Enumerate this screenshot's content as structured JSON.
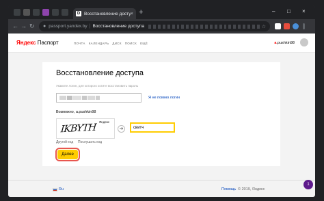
{
  "browser": {
    "tab_favicon": "D",
    "tab_title": "Восстановление досту",
    "tab_close_glyph": "×",
    "new_tab_glyph": "+",
    "window_controls": {
      "minimize": "–",
      "maximize": "□",
      "close": "×"
    },
    "nav": {
      "back": "←",
      "forward": "→",
      "reload": "↻"
    },
    "url_host": "passport.yandex.by",
    "url_title": "Восстановление доступа",
    "icons": [
      "back-icon",
      "forward-icon",
      "reload-icon",
      "lock-icon",
      "star-icon",
      "extension-icon",
      "profile-icon",
      "menu-icon"
    ]
  },
  "header": {
    "logo_brand": "Яндекс",
    "logo_product": "Паспорт",
    "nav": [
      "ПОЧТА",
      "КАЛЕНДАРЬ",
      "ДИСК",
      "ПОИСК",
      "ЕЩЁ"
    ],
    "user_first": "a",
    "user_rest": ".pushkin98"
  },
  "form": {
    "title": "Восстановление доступа",
    "hint": "Укажите логин, для которого хотите восстановить пароль",
    "forgot_login": "Я не помню логин",
    "possible_label": "Возможно,",
    "possible_user": "a.pushkin98",
    "captcha_text": "ΙΚΒΥΤΗ",
    "captcha_brand": "Яндекс",
    "code_value": "свитч",
    "other_code": "Другой код",
    "listen_code": "Послушать код",
    "submit": "Далее",
    "arrow_glyph": "➜"
  },
  "footer": {
    "lang": "Ru",
    "help": "Помощь",
    "copyright": "© 2019, Яндекс",
    "badge": "1"
  },
  "colors": {
    "accent": "#ffcc00",
    "brand_red": "#ff0000",
    "link": "#0044bb",
    "focus_ring": "#e8564f"
  }
}
